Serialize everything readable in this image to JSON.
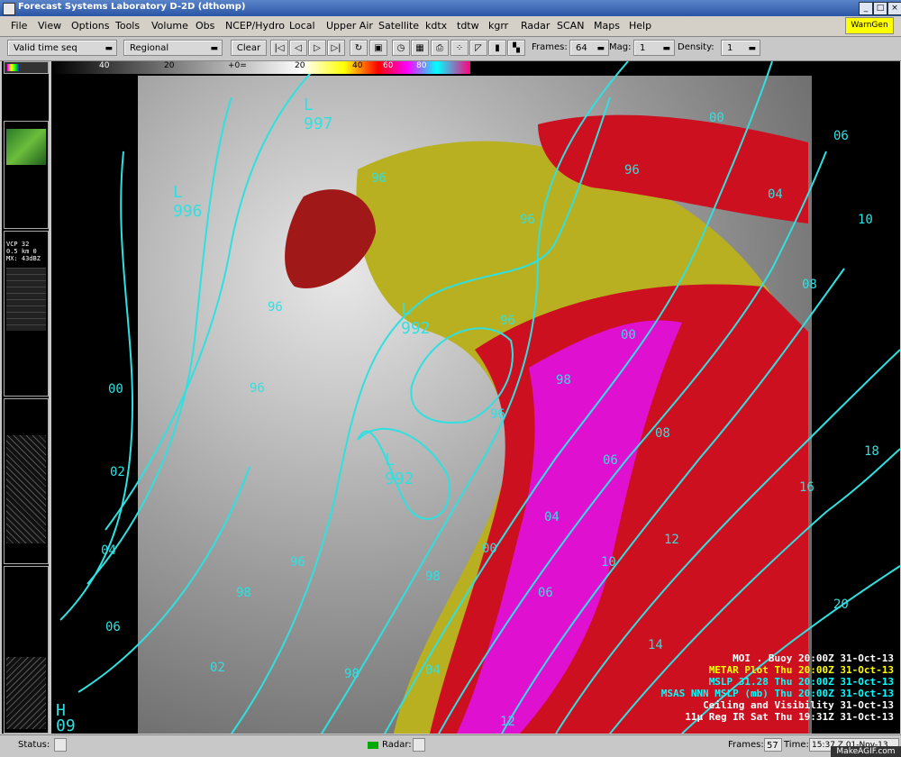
{
  "window": {
    "title": "Forecast Systems Laboratory D-2D (dthomp)"
  },
  "menu": [
    "File",
    "View",
    "Options",
    "Tools",
    "Volume",
    "Obs",
    "NCEP/Hydro",
    "Local",
    "Upper Air",
    "Satellite",
    "kdtx",
    "tdtw",
    "kgrr",
    "Radar",
    "SCAN",
    "Maps",
    "Help"
  ],
  "warngen_label": "WarnGen",
  "toolbar": {
    "time_mode": "Valid time seq",
    "scale": "Regional",
    "clear": "Clear",
    "frames_label": "Frames:",
    "frames_value": "64",
    "mag_label": "Mag:",
    "mag_value": "1",
    "density_label": "Density:",
    "density_value": "1"
  },
  "colorbar": [
    "40",
    "20",
    "+0=",
    "20",
    "40",
    "60",
    "80"
  ],
  "pressure_labels": {
    "lows": [
      "997",
      "996",
      "992",
      "992"
    ],
    "highs": [
      "09"
    ],
    "isobars": [
      "96",
      "96",
      "96",
      "96",
      "96",
      "96",
      "96",
      "98",
      "98",
      "98",
      "98",
      "00",
      "00",
      "00",
      "00",
      "02",
      "02",
      "04",
      "04",
      "04",
      "04",
      "06",
      "06",
      "06",
      "06",
      "08",
      "08",
      "10",
      "10",
      "12",
      "12",
      "14",
      "16",
      "18",
      "20",
      "96"
    ]
  },
  "legend": [
    {
      "text": "MOI . Buoy",
      "time": "20:00Z 31-Oct-13",
      "color": "#ffffff"
    },
    {
      "text": "METAR Plot",
      "time": "Thu 20:00Z 31-Oct-13",
      "color": "#ffff00"
    },
    {
      "text": "MSLP 31.28",
      "time": "Thu 20:00Z 31-Oct-13",
      "color": "#00ffff"
    },
    {
      "text": "MSAS NNN MSLP (mb)",
      "time": "Thu 20:00Z 31-Oct-13",
      "color": "#00ffff"
    },
    {
      "text": "Ceiling and Visibility",
      "time": "31-Oct-13",
      "color": "#ffffff"
    },
    {
      "text": "11μ Reg IR Sat",
      "time": "Thu 19:31Z 31-Oct-13",
      "color": "#ffffff"
    }
  ],
  "status": {
    "status_label": "Status:",
    "radar_label": "Radar:",
    "frames_label": "Frames:",
    "frames_value": "57",
    "time_label": "Time:",
    "time_value": "15:37 Z 01-Nov-13",
    "watermark": "MakeAGIF.com"
  },
  "thumbs": [
    {
      "line1": "VCP 32",
      "line2": "0.5 km 0",
      "line3": "MX: 43dBZ"
    }
  ]
}
